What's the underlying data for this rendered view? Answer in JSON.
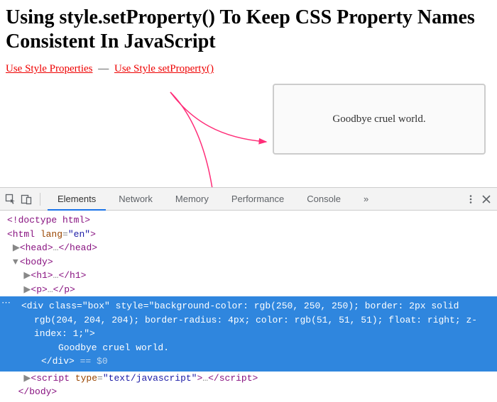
{
  "heading": "Using style.setProperty() To Keep CSS Property Names Consistent In JavaScript",
  "links": {
    "a": "Use Style Properties",
    "sep": "—",
    "b": "Use Style setProperty()"
  },
  "box_text": "Goodbye cruel world.",
  "devtools": {
    "tabs": [
      "Elements",
      "Network",
      "Memory",
      "Performance",
      "Console"
    ],
    "active": 0,
    "more": "»",
    "dom": {
      "doctype": "<!doctype html>",
      "html_open": "<html lang=\"en\">",
      "head": "<head>…</head>",
      "body_open": "<body>",
      "h1": "<h1>…</h1>",
      "p": "<p>…</p>",
      "sel_open": "<div class=\"box\" style=\"background-color: rgb(250, 250, 250); border: 2px solid rgb(204, 204, 204); border-radius: 4px; color: rgb(51, 51, 51); float: right; z-index: 1;\">",
      "sel_text": "Goodbye cruel world.",
      "sel_close": "</div>",
      "sel_ref": " == $0",
      "script": "<script type=\"text/javascript\">…</script>",
      "body_close": "</body>"
    }
  }
}
